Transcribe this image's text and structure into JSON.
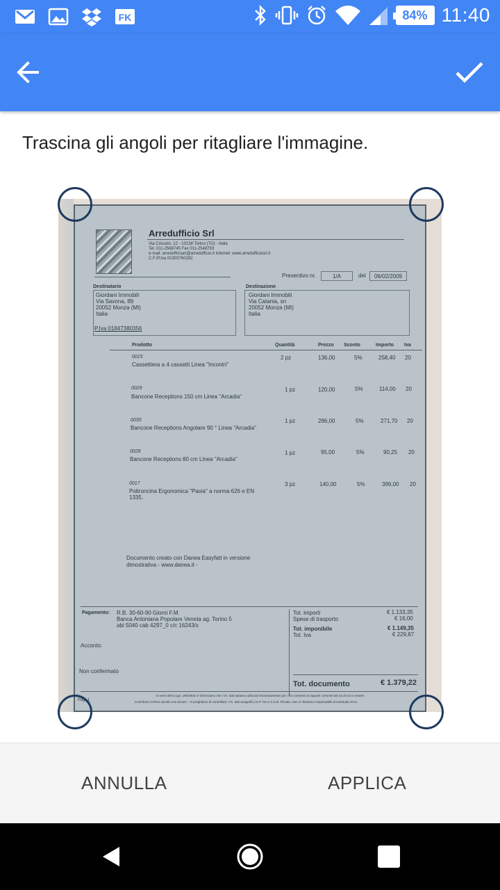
{
  "status_bar": {
    "time": "11:40",
    "battery": "84%",
    "left_icons": [
      "gmail-icon",
      "gallery-icon",
      "dropbox-icon",
      "fk-app-icon"
    ],
    "right_icons": [
      "bluetooth-icon",
      "vibrate-icon",
      "alarm-icon",
      "wifi-icon",
      "signal-icon",
      "battery-icon"
    ]
  },
  "app_bar": {
    "back_icon": "arrow-back-icon",
    "confirm_icon": "check-icon",
    "color": "#4285f4"
  },
  "instruction": "Trascina gli angoli per ritagliare l'immagine.",
  "document": {
    "company": "Arredufficio Srl",
    "address_lines": [
      "Via Crissolo, 12 - 10138  Torino  (TO) - Italia",
      "Tel. 011-2568745   Fax 011-2548793",
      "e-mail: arreduffcioarl@arredufficio.it   Internet: www.arredufficiosrl.it",
      "C.F./P.Iva 01303760282"
    ],
    "quote_label": "Preventivo nr.",
    "quote_number": "1/A",
    "date_label": "del",
    "date": "06/02/2009",
    "recipient_label": "Destinatario",
    "recipient_lines": [
      "Giordani Immobili",
      "Via Savona, 89",
      "20052  Monza  (MI)",
      "Italia"
    ],
    "recipient_vat": "P.Iva 01847380356",
    "destination_label": "Destinazione",
    "destination_lines": [
      "Giordani Immobili",
      "Via Catania, sn",
      "20052  Monza  (MI)",
      "Italia"
    ],
    "columns": [
      "Prodotto",
      "Quantità",
      "Prezzo",
      "Sconto",
      "Importo",
      "Iva"
    ],
    "items": [
      {
        "code": "0015",
        "desc": "Cassettiera a 4 cassetti Linea \"Incontri\"",
        "desc2": "",
        "qty": "2 pz",
        "price": "136,00",
        "discount": "5%",
        "amount": "258,40",
        "vat": "20"
      },
      {
        "code": "0029",
        "desc": "Bancone Receptions 150 cm Linea \"Arcadia\"",
        "desc2": "",
        "qty": "1 pz",
        "price": "120,00",
        "discount": "5%",
        "amount": "114,00",
        "vat": "20"
      },
      {
        "code": "0030",
        "desc": "Bancone Receptions Angolare 90 ° Linea \"Arcadia\"",
        "desc2": "",
        "qty": "1 pz",
        "price": "286,00",
        "discount": "5%",
        "amount": "271,70",
        "vat": "20"
      },
      {
        "code": "0028",
        "desc": "Bancone Receptions 80 cm Linea \"Arcadia\"",
        "desc2": "",
        "qty": "1 pz",
        "price": "95,00",
        "discount": "5%",
        "amount": "90,25",
        "vat": "20"
      },
      {
        "code": "0017",
        "desc": "Poltroncina Ergonomica \"Pavia\" a norma 626 e EN",
        "desc2": "1335.",
        "qty": "3 pz",
        "price": "140,00",
        "discount": "5%",
        "amount": "399,00",
        "vat": "20"
      }
    ],
    "note_line1": "Documento creato con Danea Easyfatt in versione",
    "note_line2": "dimostrativa  - www.danea.it -",
    "payment_label": "Pagamento:",
    "payment_lines": [
      "R.B. 30-60-90 Giorni F.M.",
      "Banca Antoniana Popolare Veneta ag. Torino 5",
      "abi 5040 cab 4297_0 c/c 16243/x"
    ],
    "deposit_label": "Acconto:",
    "not_confirmed": "Non confermato",
    "totals": {
      "importi_label": "Tot. importi",
      "importi": "€ 1.133,35",
      "spese_label": "Spese di trasporto",
      "spese": "€ 16,00",
      "imponibile_label": "Tot. imponibile",
      "imponibile": "€ 1.149,35",
      "iva_label": "Tot. Iva",
      "iva": "€ 229,87",
      "documento_label": "Tot. documento",
      "documento": "€ 1.379,22"
    },
    "footer_line1": "Ai sensi del D.Lgs. 196/2003 Vi informiamo che i Vs. dati saranno utilizzati esclusivamente per i fini connessi ai rapporti commerciali tra di noi in essere.",
    "footer_line2": "Contributo CONAI assolto ove dovuto - Vi preghiamo di controllare i Vs. dati anagrafici, la P. IVA e il Cod. Fiscale. Non ci riteniamo responsabili di eventuali errori.",
    "page_label": "Pag. 1"
  },
  "actions": {
    "cancel": "ANNULLA",
    "apply": "APPLICA"
  },
  "nav_bar": {
    "icons": [
      "nav-back-icon",
      "nav-home-icon",
      "nav-recents-icon"
    ]
  }
}
